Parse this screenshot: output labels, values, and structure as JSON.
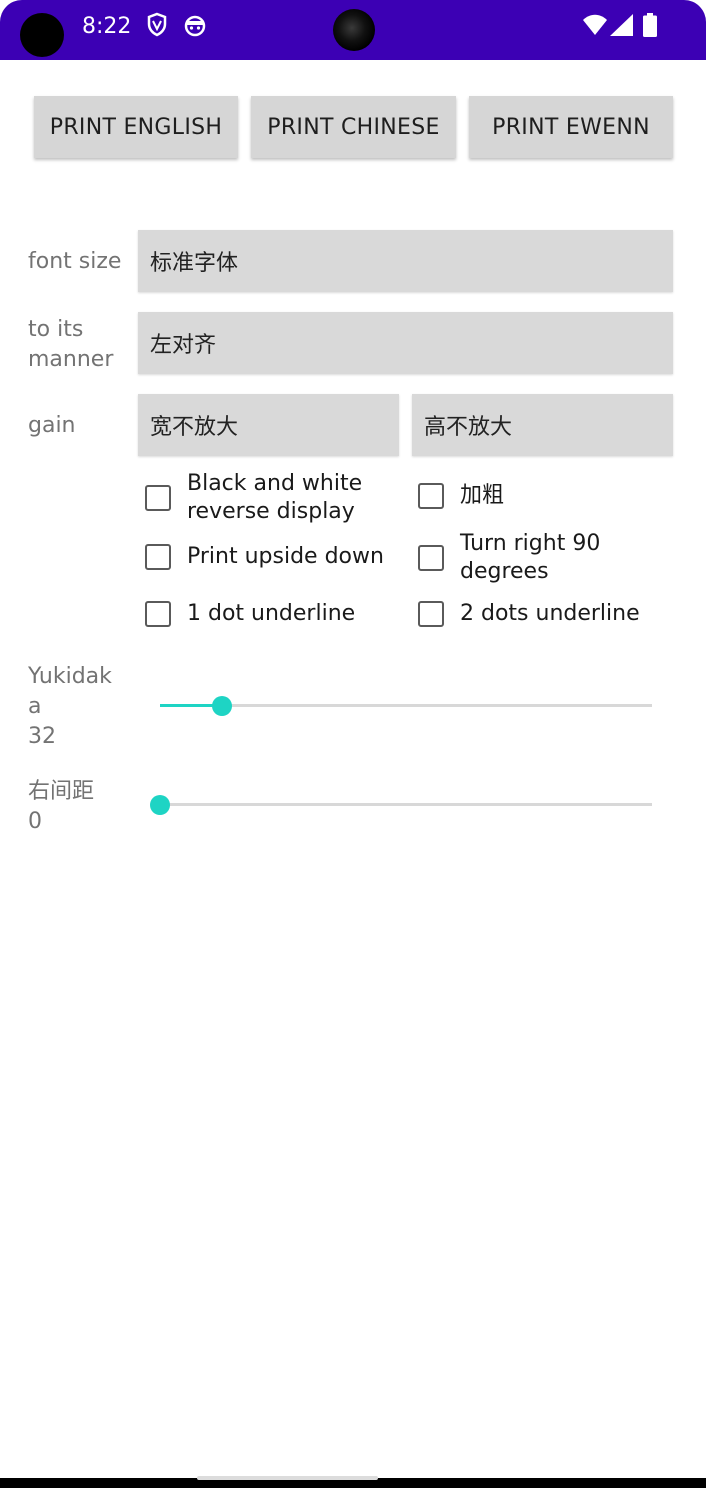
{
  "status_bar": {
    "time": "8:22",
    "icons": [
      "shield-icon",
      "android-face-icon",
      "wifi-icon",
      "signal-icon",
      "battery-icon"
    ],
    "background": "#3c00b4"
  },
  "buttons": {
    "print_english": "PRINT ENGLISH",
    "print_chinese": "PRINT CHINESE",
    "print_ewenn": "PRINT EWENN"
  },
  "form": {
    "font_size_label": "font size",
    "font_size_value": "标准字体",
    "alignment_label_line1": "to its",
    "alignment_label_line2": "manner",
    "alignment_value": "左对齐",
    "gain_label": "gain",
    "width_gain_value": "宽不放大",
    "height_gain_value": "高不放大"
  },
  "checkboxes": {
    "reverse_line1": "Black and white",
    "reverse_line2": "reverse display",
    "bold": "加粗",
    "upside_down": "Print upside down",
    "turn_right_line1": "Turn right 90",
    "turn_right_line2": "degrees",
    "underline_1": "1 dot underline",
    "underline_2": "2 dots underline"
  },
  "sliders": {
    "line_height_label_line1": "Yukidak",
    "line_height_label_line2": "a",
    "line_height_value": "32",
    "line_height_fraction": 0.126,
    "right_margin_label": "右间距",
    "right_margin_value": "0",
    "right_margin_fraction": 0.0,
    "accent_color": "#1ed4c4"
  }
}
